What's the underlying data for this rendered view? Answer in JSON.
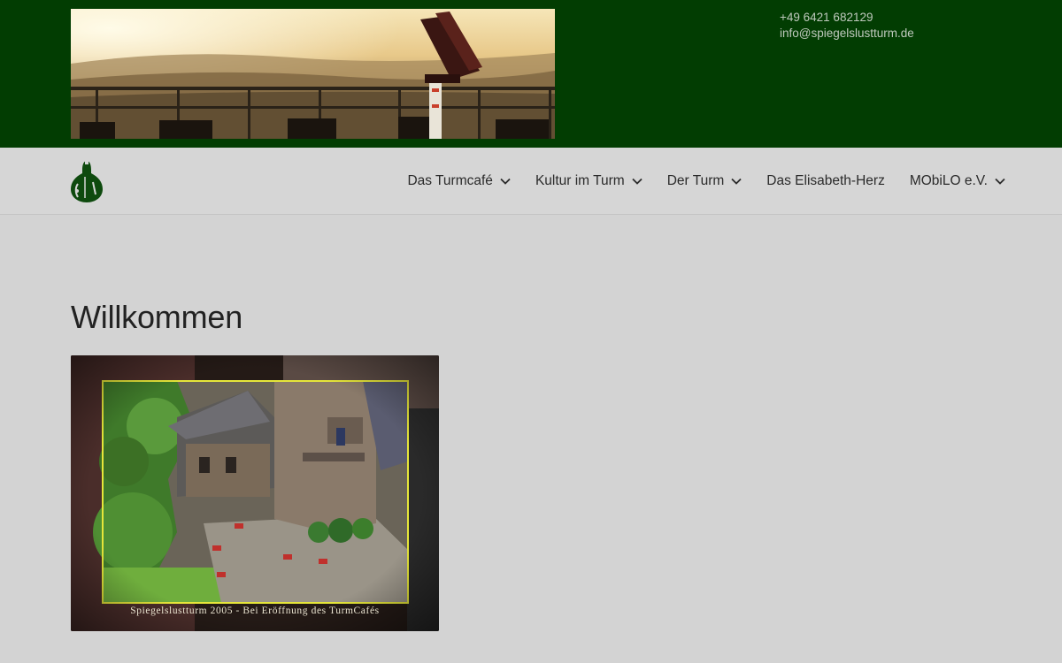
{
  "header": {
    "phone": "+49 6421 682129",
    "email": "info@spiegelslustturm.de",
    "banner_image": "sunset-panorama-with-binocular-viewer",
    "background_color": "#023d02"
  },
  "logo": {
    "icon": "tower-logo-icon",
    "color": "#0e4a0e"
  },
  "nav": {
    "items": [
      {
        "label": "Das Turmcafé",
        "has_dropdown": true
      },
      {
        "label": "Kultur im Turm",
        "has_dropdown": true
      },
      {
        "label": "Der Turm",
        "has_dropdown": true
      },
      {
        "label": "Das Elisabeth-Herz",
        "has_dropdown": false
      },
      {
        "label": "MObiLO e.V.",
        "has_dropdown": true
      }
    ]
  },
  "main": {
    "title": "Willkommen",
    "photo": {
      "subject": "aerial-view-of-tower-cafe-courtyard",
      "caption": "Spiegelslustturm 2005 - Bei Eröffnung des TurmCafés"
    }
  }
}
